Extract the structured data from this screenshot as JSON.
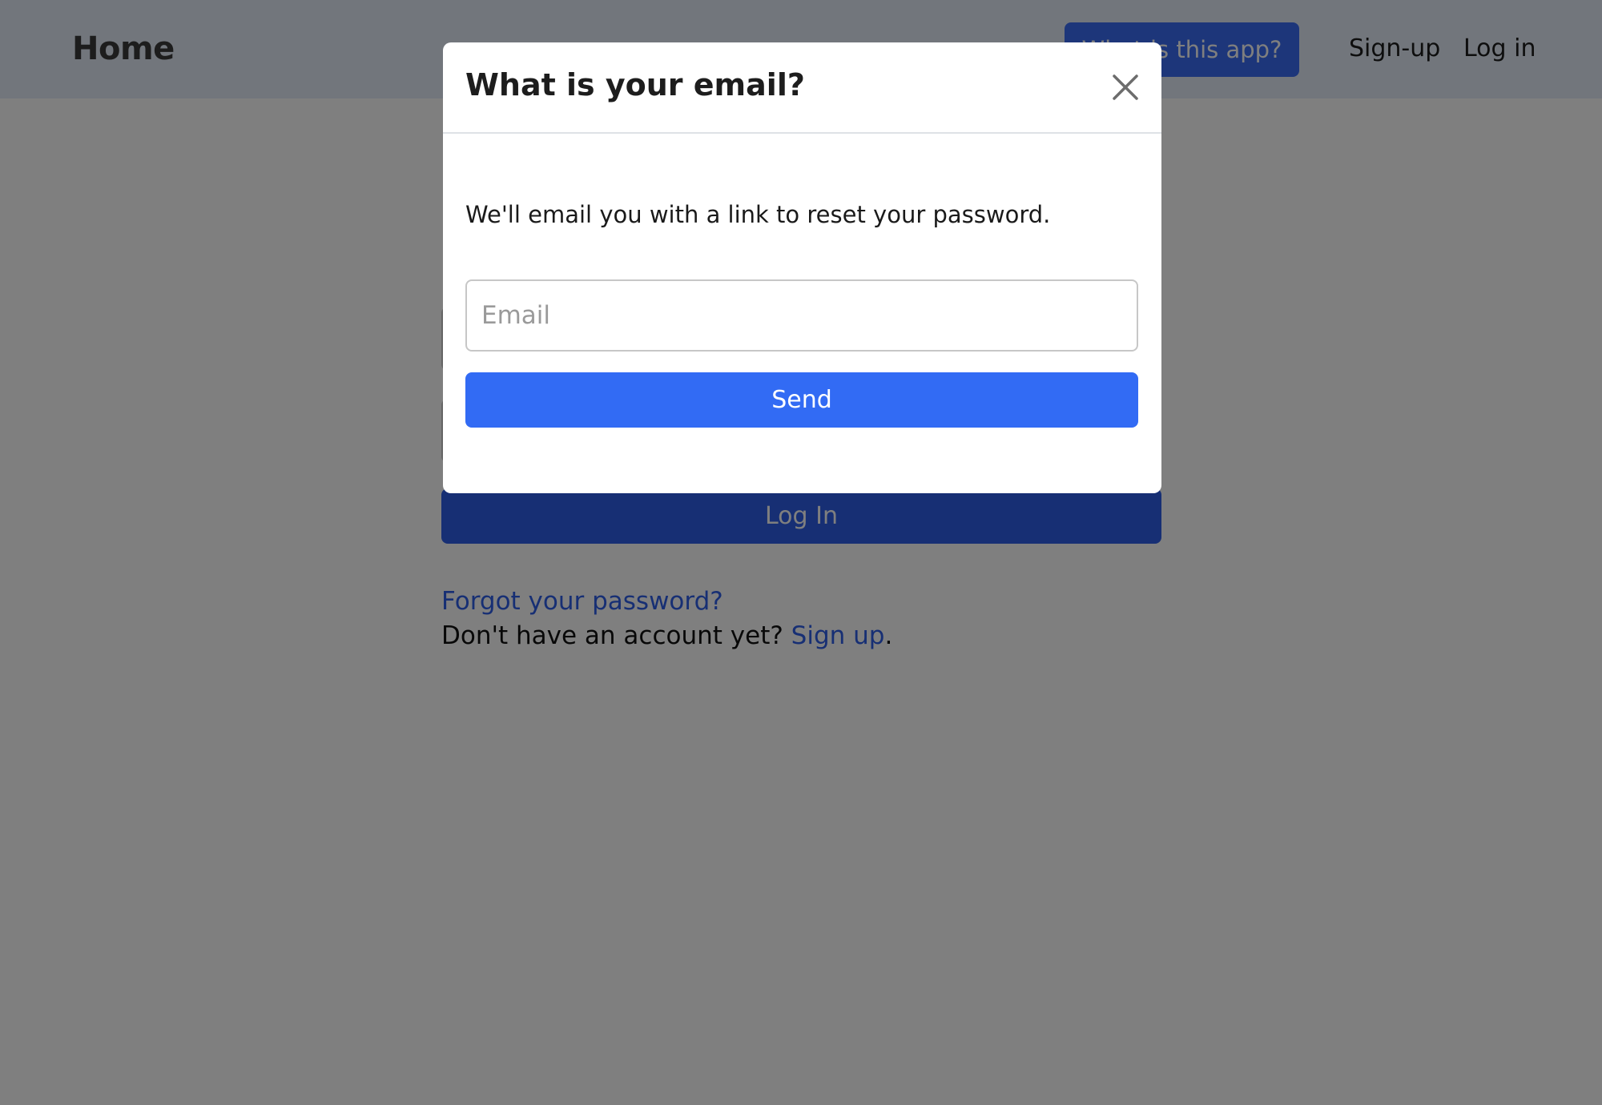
{
  "navbar": {
    "brand": "Home",
    "about_button": "What is this app?",
    "links": [
      "Sign-up",
      "Log in"
    ]
  },
  "login_form": {
    "submit_label": "Log In",
    "forgot_password": "Forgot your password?",
    "no_account_text": "Don't have an account yet?",
    "signup_link": "Sign up",
    "signup_suffix": "."
  },
  "modal": {
    "title": "What is your email?",
    "description": "We'll email you with a link to reset your password.",
    "email_placeholder": "Email",
    "email_value": "",
    "send_label": "Send",
    "close_icon": "close-icon"
  },
  "colors": {
    "primary": "#326bf4",
    "navbar_bg": "#e4edf9",
    "backdrop": "rgba(0,0,0,0.5)"
  }
}
